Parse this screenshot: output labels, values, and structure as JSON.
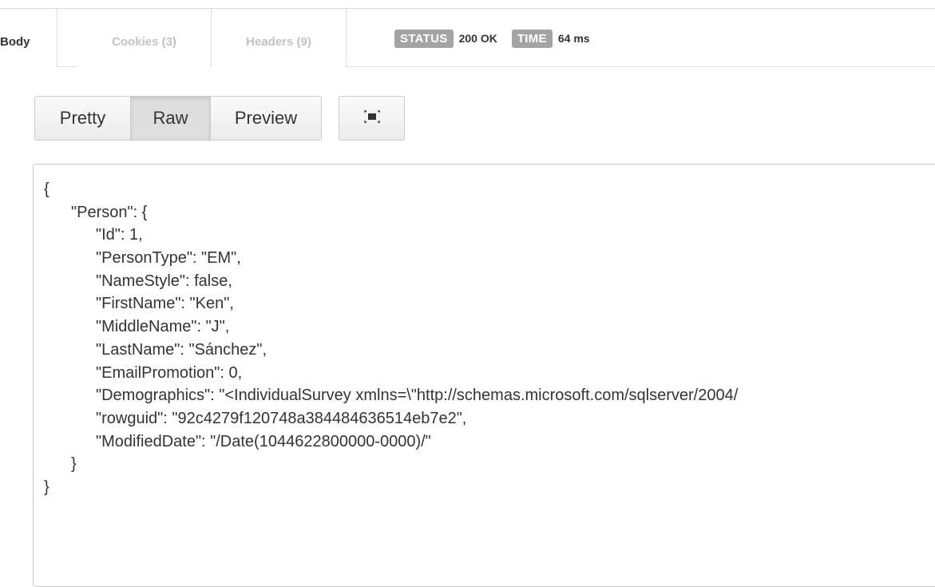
{
  "tabs": {
    "body": "Body",
    "cookies": "Cookies (3)",
    "headers": "Headers (9)"
  },
  "status": {
    "status_label": "STATUS",
    "status_value": "200 OK",
    "time_label": "TIME",
    "time_value": "64 ms"
  },
  "view_modes": {
    "pretty": "Pretty",
    "raw": "Raw",
    "preview": "Preview",
    "selected": "Raw"
  },
  "wrap_button": {
    "icon": "wrap-toggle-icon"
  },
  "response_lines": [
    "{",
    "\"Person\": {",
    "\"Id\": 1,",
    "\"PersonType\": \"EM\",",
    "\"NameStyle\": false,",
    "\"FirstName\": \"Ken\",",
    "\"MiddleName\": \"J\",",
    "\"LastName\": \"Sánchez\",",
    "\"EmailPromotion\": 0,",
    "\"Demographics\": \"<IndividualSurvey xmlns=\\\"http://schemas.microsoft.com/sqlserver/2004/",
    "\"rowguid\": \"92c4279f120748a384484636514eb7e2\",",
    "\"ModifiedDate\": \"/Date(1044622800000-0000)/\"",
    "}",
    "}"
  ],
  "colors": {
    "pill_bg": "#a3a3a3",
    "border": "#cccccc",
    "inactive_tab_text": "#c2c2c2"
  }
}
